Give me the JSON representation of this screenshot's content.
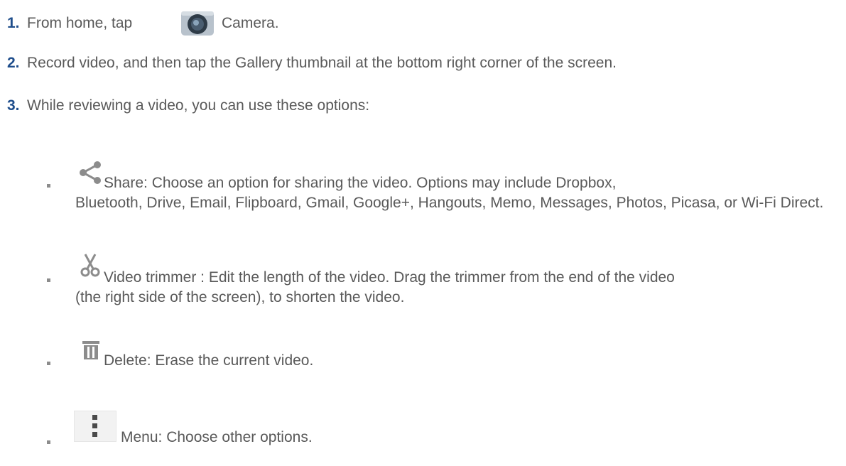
{
  "steps": [
    {
      "number": "1.",
      "text_before": "From home, tap",
      "icon": "camera-icon",
      "text_after": "Camera."
    },
    {
      "number": "2.",
      "text": "Record video, and then tap the Gallery thumbnail at the bottom right corner of the screen."
    },
    {
      "number": "3.",
      "text": "While reviewing a video, you can use these options:"
    }
  ],
  "options": [
    {
      "icon": "share-icon",
      "label": "Share",
      "first_line": ": Choose an option for sharing the video. Options may include Dropbox,",
      "rest": "Bluetooth, Drive, Email, Flipboard, Gmail, Google+, Hangouts, Memo, Messages, Photos, Picasa, or Wi-Fi Direct."
    },
    {
      "icon": "scissors-icon",
      "label": "Video trimmer",
      "first_line": " : Edit the length of the video. Drag the trimmer from the end of the video",
      "rest": "(the right side of the screen), to shorten the video."
    },
    {
      "icon": "trash-icon",
      "label": "Delete",
      "first_line": ": Erase the current video."
    },
    {
      "icon": "menu-icon",
      "label": "Menu",
      "first_line": ": Choose other options."
    }
  ],
  "colors": {
    "text": "#595959",
    "number": "#1f4e8c",
    "icon": "#8c8c8c"
  }
}
